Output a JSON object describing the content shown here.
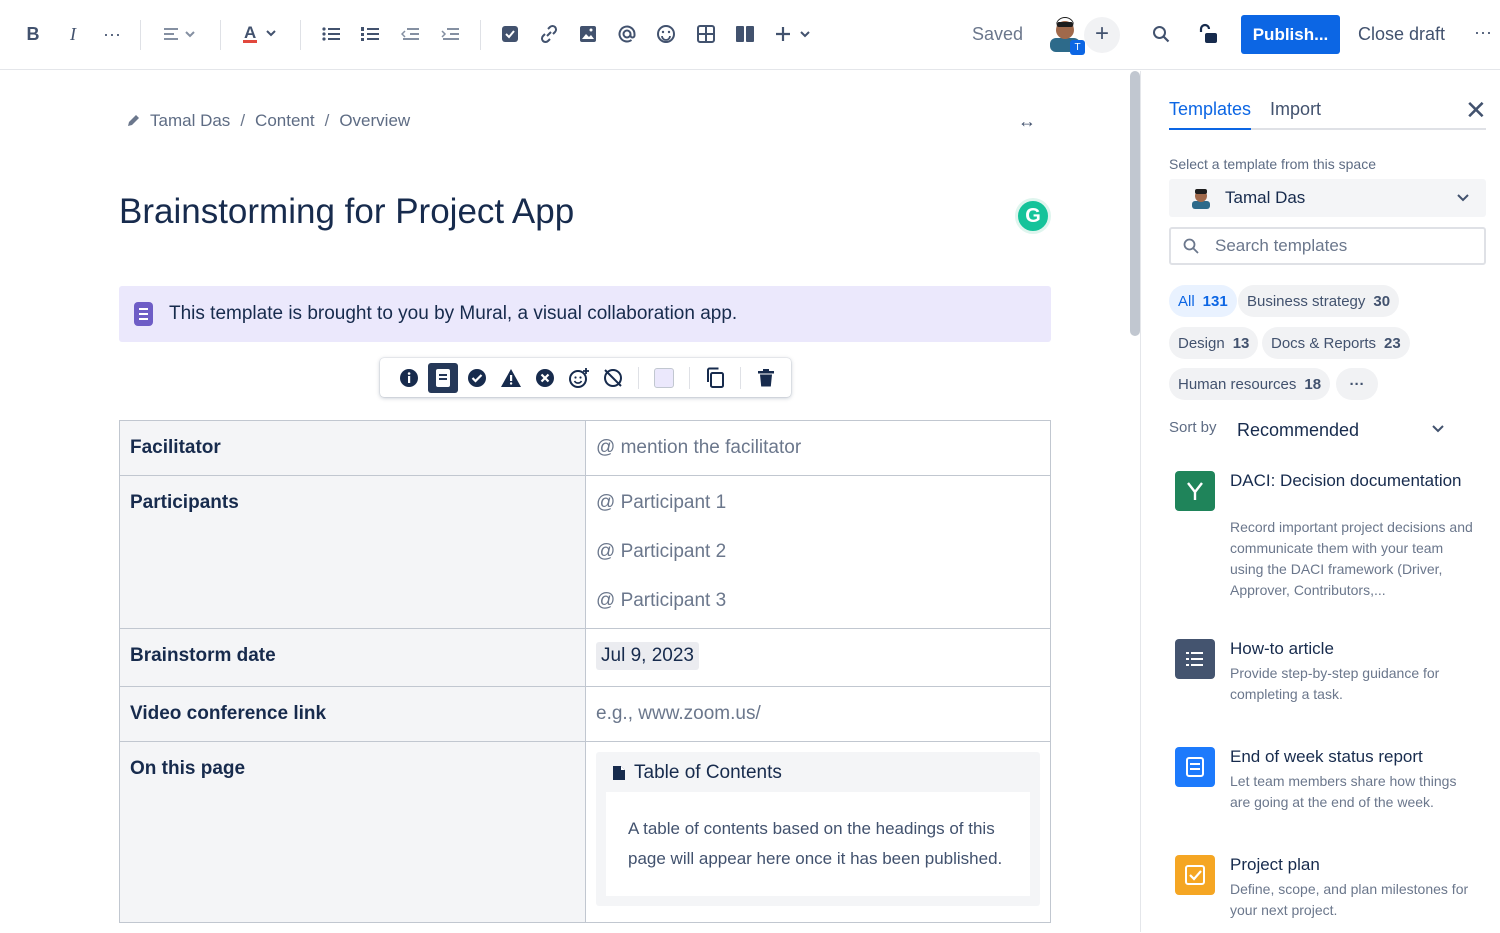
{
  "toolbar": {
    "bold": "B",
    "italic": "I",
    "more": "···",
    "saved": "Saved",
    "avatar_badge": "T",
    "publish": "Publish...",
    "close_draft": "Close draft",
    "overflow": "···"
  },
  "breadcrumb": {
    "items": [
      "Tamal Das",
      "Content",
      "Overview"
    ],
    "separator": "/"
  },
  "page": {
    "title": "Brainstorming for Project App",
    "grammarly": "G"
  },
  "note_panel": {
    "text": "This template is brought to you by Mural, a visual collaboration app."
  },
  "info_table": {
    "rows": [
      {
        "label": "Facilitator",
        "value": "@ mention the facilitator"
      },
      {
        "label": "Participants",
        "values": [
          "@ Participant 1",
          "@ Participant 2",
          "@ Participant 3"
        ]
      },
      {
        "label": "Brainstorm date",
        "value": "Jul 9, 2023"
      },
      {
        "label": "Video conference link",
        "value": "e.g., www.zoom.us/"
      },
      {
        "label": "On this page",
        "toc_title": "Table of Contents",
        "toc_body": "A table of contents based on the headings of this page will appear here once it has been published."
      }
    ]
  },
  "sidebar": {
    "tabs": [
      "Templates",
      "Import"
    ],
    "select_label": "Select a template from this space",
    "space": "Tamal Das",
    "search_placeholder": "Search templates",
    "chips": [
      {
        "label": "All",
        "count": "131"
      },
      {
        "label": "Business strategy",
        "count": "30"
      },
      {
        "label": "Design",
        "count": "13"
      },
      {
        "label": "Docs & Reports",
        "count": "23"
      },
      {
        "label": "Human resources",
        "count": "18"
      },
      {
        "label": "···",
        "count": ""
      }
    ],
    "sort_label": "Sort by",
    "sort_value": "Recommended",
    "templates": [
      {
        "title": "DACI: Decision documentation",
        "desc": "Record important project decisions and communicate them with your team using the DACI framework (Driver, Approver, Contributors,...",
        "color": "#1f845a"
      },
      {
        "title": "How-to article",
        "desc": "Provide step-by-step guidance for completing a task.",
        "color": "#44546f"
      },
      {
        "title": "End of week status report",
        "desc": "Let team members share how things are going at the end of the week.",
        "color": "#1d7afc"
      },
      {
        "title": "Project plan",
        "desc": "Define, scope, and plan milestones for your next project.",
        "color": "#f5a623"
      }
    ]
  },
  "colors": {
    "accent": "#0c66e4",
    "note_bg": "#ebe8fc",
    "note_icon": "#6e5dc6"
  }
}
